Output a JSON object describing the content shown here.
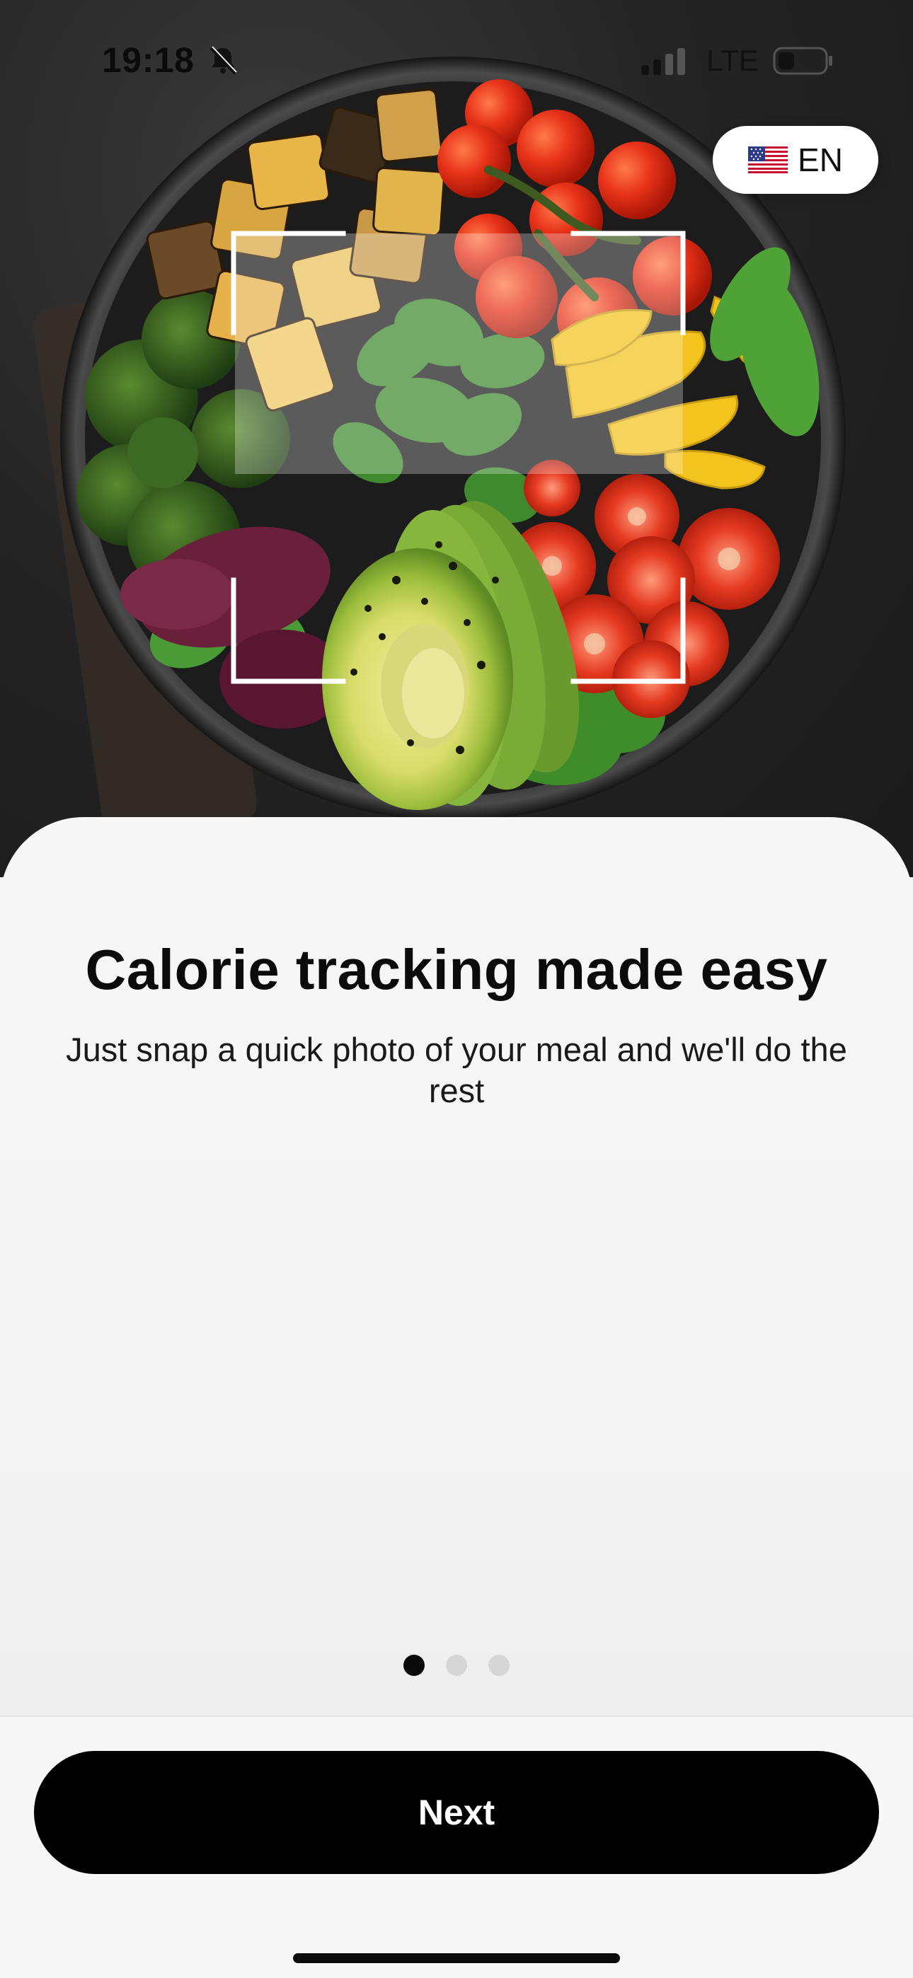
{
  "status_bar": {
    "time": "19:18",
    "network": "LTE",
    "icons": [
      "bell-slash-icon",
      "signal-icon",
      "battery-icon"
    ]
  },
  "language": {
    "flag": "us-flag-icon",
    "code": "EN"
  },
  "hero": {
    "image": "food-bowl-photo",
    "overlay": "scan-frame-icon"
  },
  "onboarding": {
    "title": "Calorie tracking made easy",
    "subtitle": "Just snap a quick photo of your meal and we'll do the rest",
    "page_indicator": {
      "current": 1,
      "total": 3
    }
  },
  "footer": {
    "next_label": "Next"
  },
  "colors": {
    "primary_button": "#000000",
    "button_text": "#ffffff",
    "sheet_background": "#f6f6f6",
    "dot_active": "#0a0a0a",
    "dot_inactive": "#d6d6d6"
  }
}
